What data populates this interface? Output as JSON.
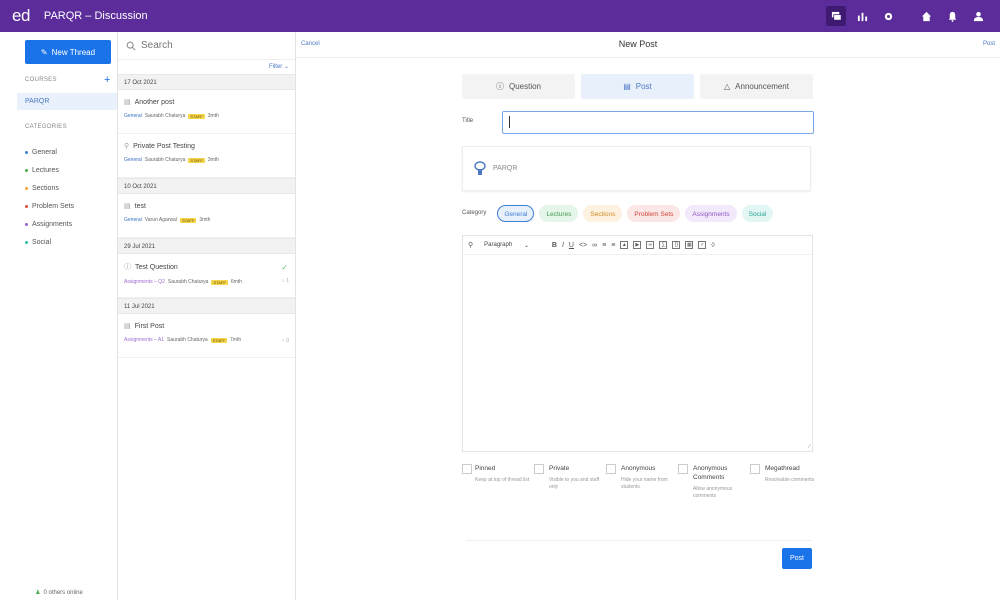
{
  "header": {
    "logo": "ed",
    "title": "PARQR – Discussion",
    "icons": [
      "discussion-icon",
      "chart-icon",
      "settings-icon",
      "home-icon",
      "bell-icon",
      "user-icon"
    ]
  },
  "sidebar": {
    "new_thread_label": "New Thread",
    "courses_label": "COURSES",
    "course_name": "PARQR",
    "categories_label": "CATEGORIES",
    "categories": [
      {
        "label": "General",
        "color": "#3f7fd6"
      },
      {
        "label": "Lectures",
        "color": "#4caf50"
      },
      {
        "label": "Sections",
        "color": "#f2a33a"
      },
      {
        "label": "Problem Sets",
        "color": "#e0483e"
      },
      {
        "label": "Assignments",
        "color": "#9c5fd0"
      },
      {
        "label": "Social",
        "color": "#2fbfb0"
      }
    ],
    "online_text": "0 others online"
  },
  "thread_list": {
    "search_placeholder": "Search",
    "filter_label": "Filter",
    "groups": [
      {
        "date": "17 Oct 2021",
        "threads": [
          {
            "title": "Another post",
            "category": "General",
            "author": "Saurabh Chaturya",
            "staff": "STAFF",
            "time": "3mth"
          },
          {
            "title": "Private Post Testing",
            "category": "General",
            "author": "Saurabh Chaturya",
            "staff": "STAFF",
            "time": "3mth"
          }
        ]
      },
      {
        "date": "10 Oct 2021",
        "threads": [
          {
            "title": "test",
            "category": "General",
            "author": "Varun Agarwal",
            "staff": "STAFF",
            "time": "3mth"
          }
        ]
      },
      {
        "date": "29 Jul 2021",
        "threads": [
          {
            "title": "Test Question",
            "category": "Assignments – Q2",
            "author": "Saurabh Chaturya",
            "staff": "STAFF",
            "time": "6mth",
            "count": "1"
          }
        ]
      },
      {
        "date": "11 Jul 2021",
        "threads": [
          {
            "title": "First Post",
            "category": "Assignments – A1",
            "author": "Saurabh Chaturya",
            "staff": "STAFF",
            "time": "7mth",
            "count": "0"
          }
        ]
      }
    ]
  },
  "main": {
    "cancel_label": "Cancel",
    "title": "New Post",
    "post_label": "Post",
    "type_tabs": [
      "Question",
      "Post",
      "Announcement"
    ],
    "title_label": "Title",
    "title_value": "",
    "course_name": "PARQR",
    "category_label": "Category",
    "category_chips": [
      {
        "label": "General",
        "bg": "#e8f0fb",
        "fg": "#3f7fd6",
        "border": "#3f7fd6"
      },
      {
        "label": "Lectures",
        "bg": "#e6f5e9",
        "fg": "#3d9a4d",
        "border": "#e6f5e9"
      },
      {
        "label": "Sections",
        "bg": "#fdf1e0",
        "fg": "#d38721",
        "border": "#fdf1e0"
      },
      {
        "label": "Problem Sets",
        "bg": "#fbe7e6",
        "fg": "#d0453c",
        "border": "#fbe7e6"
      },
      {
        "label": "Assignments",
        "bg": "#f2eafa",
        "fg": "#8e55c7",
        "border": "#f2eafa"
      },
      {
        "label": "Social",
        "bg": "#e2f6f4",
        "fg": "#27a598",
        "border": "#e2f6f4"
      }
    ],
    "editor": {
      "paragraph_label": "Paragraph"
    },
    "options": [
      {
        "title": "Pinned",
        "desc": "Keep at top of thread list"
      },
      {
        "title": "Private",
        "desc": "Visible to you and staff only"
      },
      {
        "title": "Anonymous",
        "desc": "Hide your name from students"
      },
      {
        "title": "Anonymous Comments",
        "desc": "Allow anonymous comments"
      },
      {
        "title": "Megathread",
        "desc": "Resolvable comments"
      }
    ],
    "submit_label": "Post"
  }
}
